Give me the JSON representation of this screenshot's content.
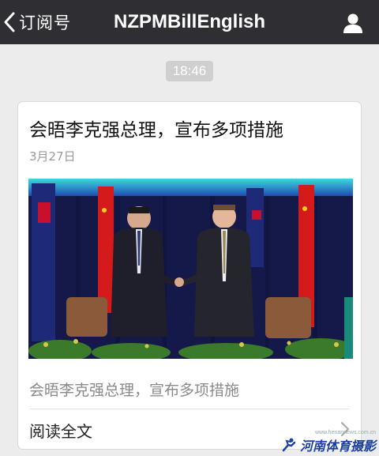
{
  "nav": {
    "back_label": "订阅号",
    "title": "NZPMBillEnglish"
  },
  "message": {
    "time": "18:46"
  },
  "article": {
    "title": "会晤李克强总理，宣布多项措施",
    "date": "3月27日",
    "summary": "会晤李克强总理，宣布多项措施",
    "read_more": "阅读全文"
  },
  "watermark": {
    "url": "www.henannews.com.cn",
    "text": "河南体育摄影"
  },
  "icons": {
    "back": "chevron-left-icon",
    "profile": "person-icon",
    "read_more": "chevron-right-icon"
  },
  "colors": {
    "topbar": "#2f2f33",
    "background": "#ececec",
    "watermark": "#1a3fa6"
  }
}
